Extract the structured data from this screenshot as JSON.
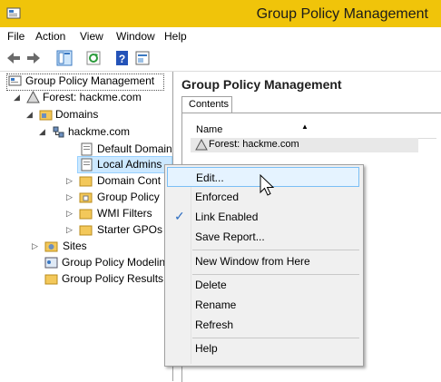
{
  "window": {
    "title": "Group Policy Management"
  },
  "menu": {
    "items": [
      "File",
      "Action",
      "View",
      "Window",
      "Help"
    ]
  },
  "tree": {
    "root": "Group Policy Management",
    "forest": "Forest: hackme.com",
    "domains": "Domains",
    "domain": "hackme.com",
    "default_domain": "Default Domain",
    "local_admins": "Local Admins",
    "domain_controllers": "Domain Cont",
    "group_policy_objects": "Group Policy",
    "wmi_filters": "WMI Filters",
    "starter_gpos": "Starter GPOs",
    "sites": "Sites",
    "modeling": "Group Policy Modeling",
    "results": "Group Policy Results"
  },
  "right": {
    "title": "Group Policy Management",
    "tab": "Contents",
    "column": "Name",
    "row": "Forest: hackme.com"
  },
  "context_menu": {
    "edit": "Edit...",
    "enforced": "Enforced",
    "link_enabled": "Link Enabled",
    "save_report": "Save Report...",
    "new_window": "New Window from Here",
    "delete": "Delete",
    "rename": "Rename",
    "refresh": "Refresh",
    "help": "Help"
  },
  "colors": {
    "titlebar": "#f0c40a",
    "highlight": "#e5f3ff",
    "accent": "#2e6ec2"
  }
}
